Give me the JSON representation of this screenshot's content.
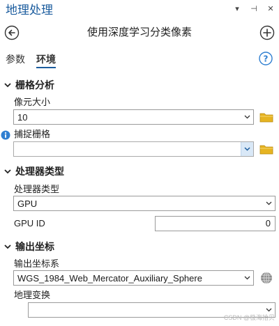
{
  "pane_title": "地理处理",
  "window_controls": {
    "dropdown": "▾",
    "pin": "⊣",
    "close": "✕"
  },
  "tool_title": "使用深度学习分类像素",
  "tabs": [
    {
      "label": "参数",
      "active": false
    },
    {
      "label": "环境",
      "active": true
    }
  ],
  "sections": {
    "raster_analysis": {
      "title": "栅格分析",
      "cell_size": {
        "label": "像元大小",
        "value": "10"
      },
      "snap_raster": {
        "label": "捕捉栅格",
        "value": ""
      }
    },
    "processor_type": {
      "title": "处理器类型",
      "processor": {
        "label": "处理器类型",
        "value": "GPU"
      },
      "gpu_id": {
        "label": "GPU ID",
        "value": "0"
      }
    },
    "output_coords": {
      "title": "输出坐标",
      "coord_system": {
        "label": "输出坐标系",
        "value": "WGS_1984_Web_Mercator_Auxiliary_Sphere"
      },
      "geo_transform": {
        "label": "地理变换",
        "value": ""
      }
    }
  },
  "watermark": "CSDN @极海拾贝",
  "colors": {
    "accent": "#1b5c9e",
    "folder": "#e6b422",
    "info": "#2f7fd1"
  }
}
